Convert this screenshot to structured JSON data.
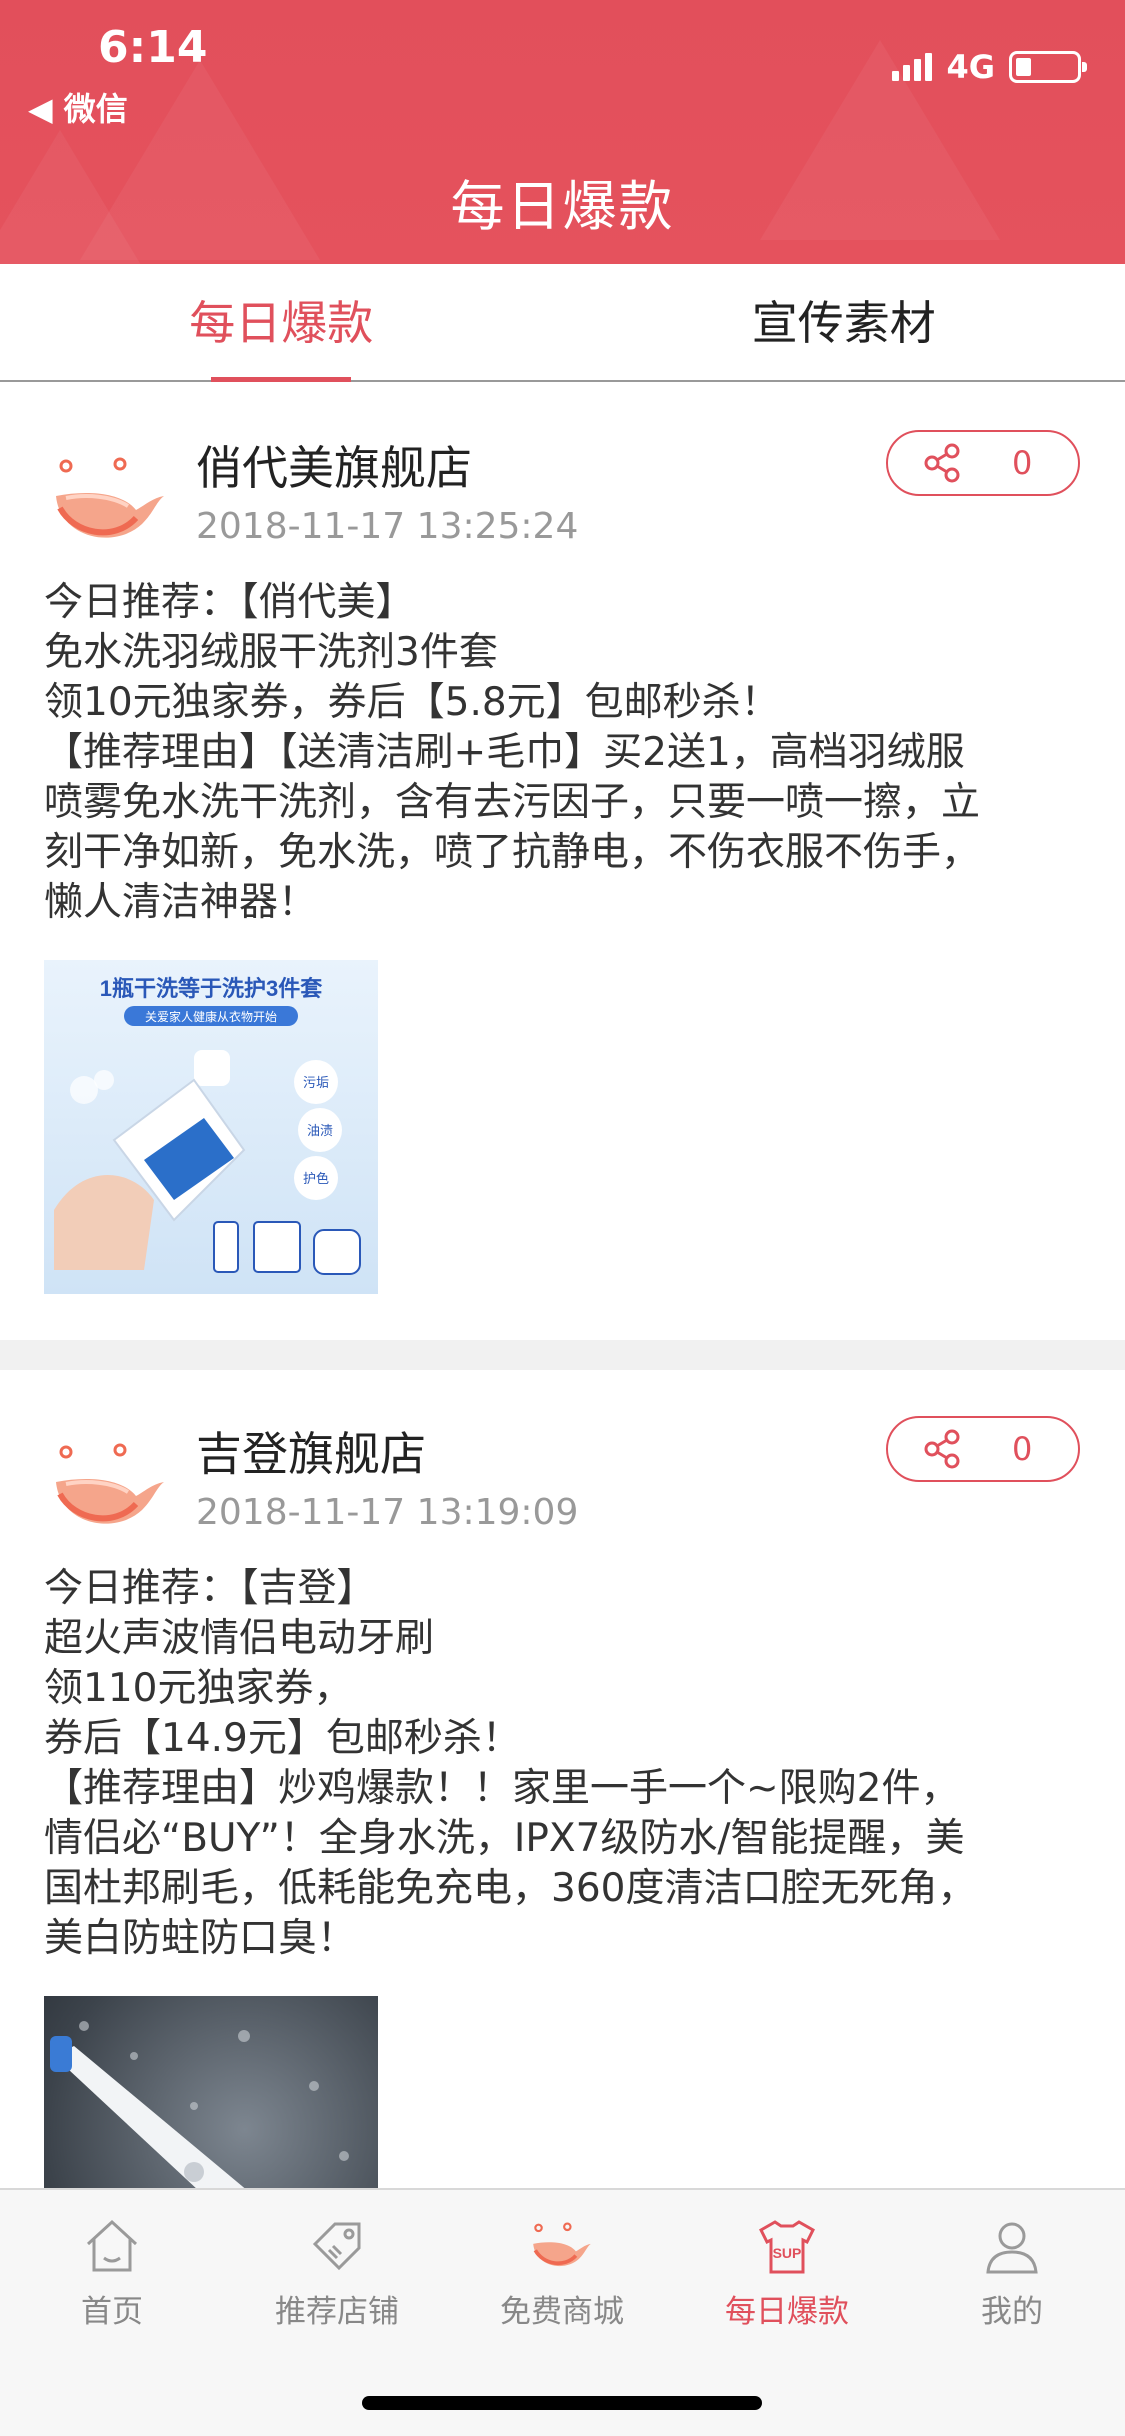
{
  "status_bar": {
    "time": "6:14",
    "back_app": "◀ 微信",
    "network": "4G",
    "battery_level": 0.25
  },
  "header": {
    "title": "每日爆款"
  },
  "tabs": [
    {
      "label": "每日爆款",
      "active": true
    },
    {
      "label": "宣传素材",
      "active": false
    }
  ],
  "posts": [
    {
      "store": "俏代美旗舰店",
      "time": "2018-11-17 13:25:24",
      "share_count": "0",
      "lines": [
        "今日推荐：【俏代美】",
        "免水洗羽绒服干洗剂3件套",
        "领10元独家券，券后【5.8元】包邮秒杀！",
        "【推荐理由】【送清洁刷+毛巾】买2送1，高档羽绒服",
        "喷雾免水洗干洗剂，含有去污因子，只要一喷一擦，立",
        "刻干净如新，免水洗，喷了抗静电，不伤衣服不伤手，",
        "懒人清洁神器！"
      ],
      "image": {
        "headline": "1瓶干洗等于洗护3件套",
        "subline": "关爱家人健康从衣物开始",
        "tags": [
          "污垢",
          "油渍",
          "护色"
        ]
      }
    },
    {
      "store": "吉登旗舰店",
      "time": "2018-11-17 13:19:09",
      "share_count": "0",
      "lines": [
        "今日推荐：【吉登】",
        "超火声波情侣电动牙刷",
        "领110元独家券，",
        "券后【14.9元】包邮秒杀！",
        "【推荐理由】炒鸡爆款！！家里一手一个~限购2件，",
        "情侣必“BUY”！全身水洗，IPX7级防水/智能提醒，美",
        "国杜邦刷毛，低耗能免充电，360度清洁口腔无死角，",
        "美白防蛀防口臭！"
      ]
    }
  ],
  "bottom_nav": [
    {
      "label": "首页",
      "icon": "home-icon",
      "active": false
    },
    {
      "label": "推荐店铺",
      "icon": "tag-icon",
      "active": false
    },
    {
      "label": "免费商城",
      "icon": "whale-logo-icon",
      "active": false
    },
    {
      "label": "每日爆款",
      "icon": "shirt-sup-icon",
      "active": true
    },
    {
      "label": "我的",
      "icon": "user-icon",
      "active": false
    }
  ],
  "colors": {
    "brand": "#e0505c",
    "header_bg": "#e24f5b",
    "muted_text": "#999999"
  }
}
